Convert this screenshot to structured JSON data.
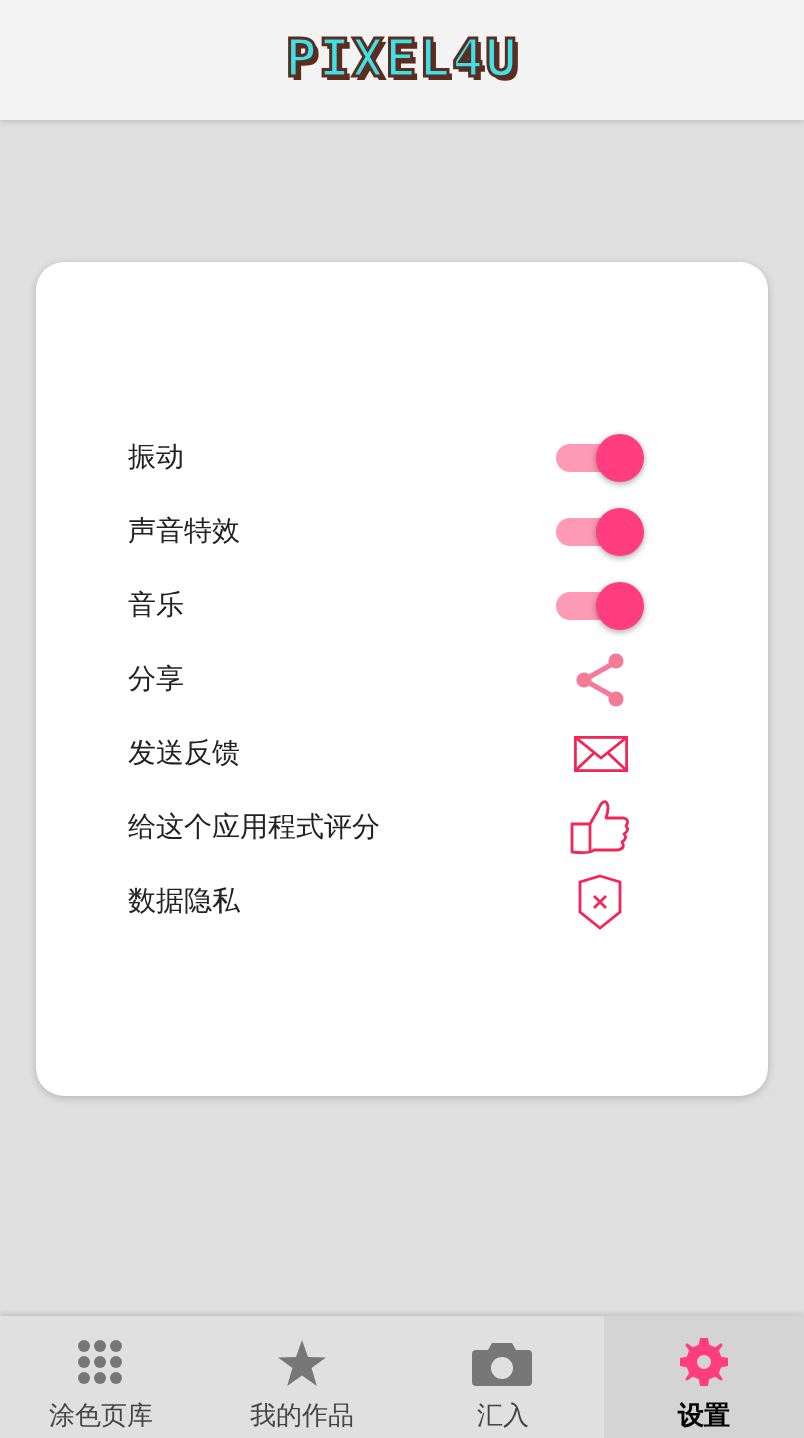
{
  "header": {
    "logo": "PIXEL4U"
  },
  "settings": [
    {
      "label": "振动",
      "kind": "toggle",
      "on": true
    },
    {
      "label": "声音特效",
      "kind": "toggle",
      "on": true
    },
    {
      "label": "音乐",
      "kind": "toggle",
      "on": true
    },
    {
      "label": "分享",
      "kind": "share"
    },
    {
      "label": "发送反馈",
      "kind": "feedback"
    },
    {
      "label": "给这个应用程式评分",
      "kind": "rate"
    },
    {
      "label": "数据隐私",
      "kind": "privacy"
    }
  ],
  "nav": [
    {
      "label": "涂色页库",
      "kind": "grid",
      "selected": false
    },
    {
      "label": "我的作品",
      "kind": "star",
      "selected": false
    },
    {
      "label": "汇入",
      "kind": "camera",
      "selected": false
    },
    {
      "label": "设置",
      "kind": "gear",
      "selected": true
    }
  ]
}
